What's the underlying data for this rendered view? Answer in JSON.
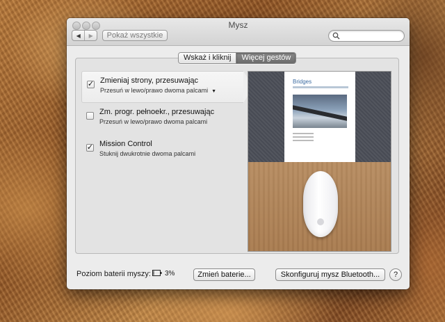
{
  "window": {
    "title": "Mysz"
  },
  "toolbar": {
    "back_icon": "◀",
    "forward_icon": "▶",
    "show_all_label": "Pokaż wszystkie",
    "search_placeholder": ""
  },
  "tabs": [
    {
      "label": "Wskaż i kliknij",
      "active": false
    },
    {
      "label": "Więcej gestów",
      "active": true
    }
  ],
  "gestures": [
    {
      "title": "Zmieniaj strony, przesuwając",
      "subtitle": "Przesuń w lewo/prawo dwoma palcami",
      "checked": true,
      "selected": true,
      "has_dropdown": true,
      "check_mark": "✓"
    },
    {
      "title": "Zm. progr. pełnoekr., przesuwając",
      "subtitle": "Przesuń w lewo/prawo dwoma palcami",
      "checked": false,
      "selected": false,
      "check_mark": ""
    },
    {
      "title": "Mission Control",
      "subtitle": "Stuknij dwukrotnie dwoma palcami",
      "checked": true,
      "selected": false,
      "check_mark": "✓"
    }
  ],
  "preview": {
    "doc_title": "Bridges"
  },
  "footer": {
    "battery_label": "Poziom baterii myszy:",
    "battery_level": "3%",
    "change_battery_label": "Zmień baterie...",
    "configure_bt_label": "Skonfiguruj mysz Bluetooth...",
    "help_label": "?"
  },
  "colors": {
    "active_tab": "#7a7a7a",
    "window_bg": "#ececec"
  }
}
